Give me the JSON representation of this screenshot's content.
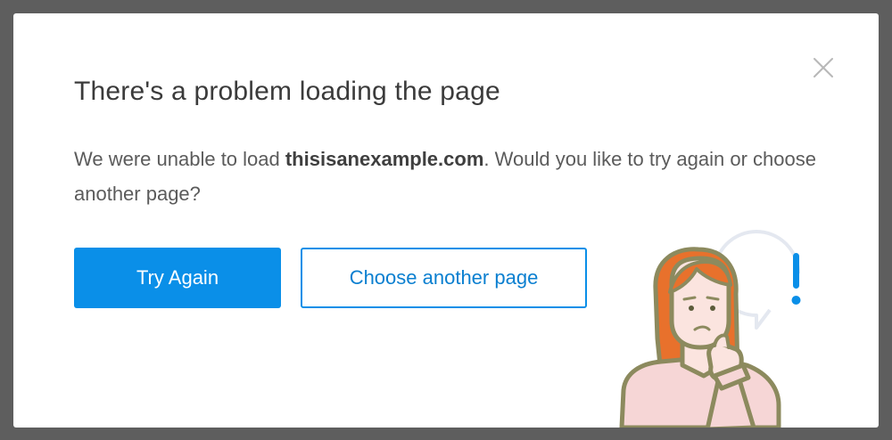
{
  "dialog": {
    "title": "There's a problem loading the page",
    "message_before": "We were unable to load ",
    "message_domain": "thisisanexample.com",
    "message_after": ". Would you like to try again or choose another page?",
    "close_icon": "close-icon",
    "try_again_label": "Try Again",
    "choose_page_label": "Choose another page",
    "alert_mark": "!"
  },
  "colors": {
    "primary": "#0a8fe8",
    "title_text": "#3b3b3b",
    "body_text": "#5b5b5b",
    "overlay": "#5e5e5e",
    "hair": "#e8712c",
    "outline": "#8c8a5e",
    "shirt": "#f6d6d6",
    "skin": "#fbe4df"
  }
}
